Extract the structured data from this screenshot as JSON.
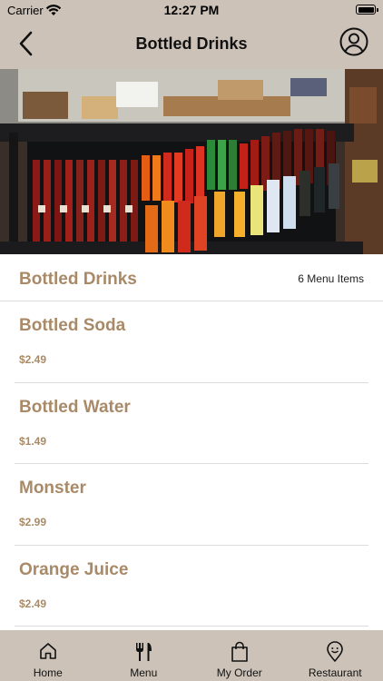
{
  "status_bar": {
    "carrier": "Carrier",
    "time": "12:27 PM",
    "icons": [
      "wifi-icon",
      "battery-icon"
    ]
  },
  "nav": {
    "title": "Bottled Drinks",
    "back_icon": "chevron-left-icon",
    "profile_icon": "user-circle-icon"
  },
  "hero": {
    "image": "display case photo of bottled drinks"
  },
  "section": {
    "title": "Bottled Drinks",
    "count": "6 Menu Items"
  },
  "items": [
    {
      "name": "Bottled Soda",
      "price": "$2.49"
    },
    {
      "name": "Bottled Water",
      "price": "$1.49"
    },
    {
      "name": "Monster",
      "price": "$2.99"
    },
    {
      "name": "Orange Juice",
      "price": "$2.49"
    }
  ],
  "tabs": [
    {
      "label": "Home",
      "icon": "home-icon"
    },
    {
      "label": "Menu",
      "icon": "fork-knife-icon"
    },
    {
      "label": "My Order",
      "icon": "shopping-bag-icon"
    },
    {
      "label": "Restaurant",
      "icon": "location-pin-icon"
    }
  ],
  "colors": {
    "bar_background": "#ccc2b8",
    "accent_brown": "#a98a68",
    "divider": "#dcdcdc"
  }
}
